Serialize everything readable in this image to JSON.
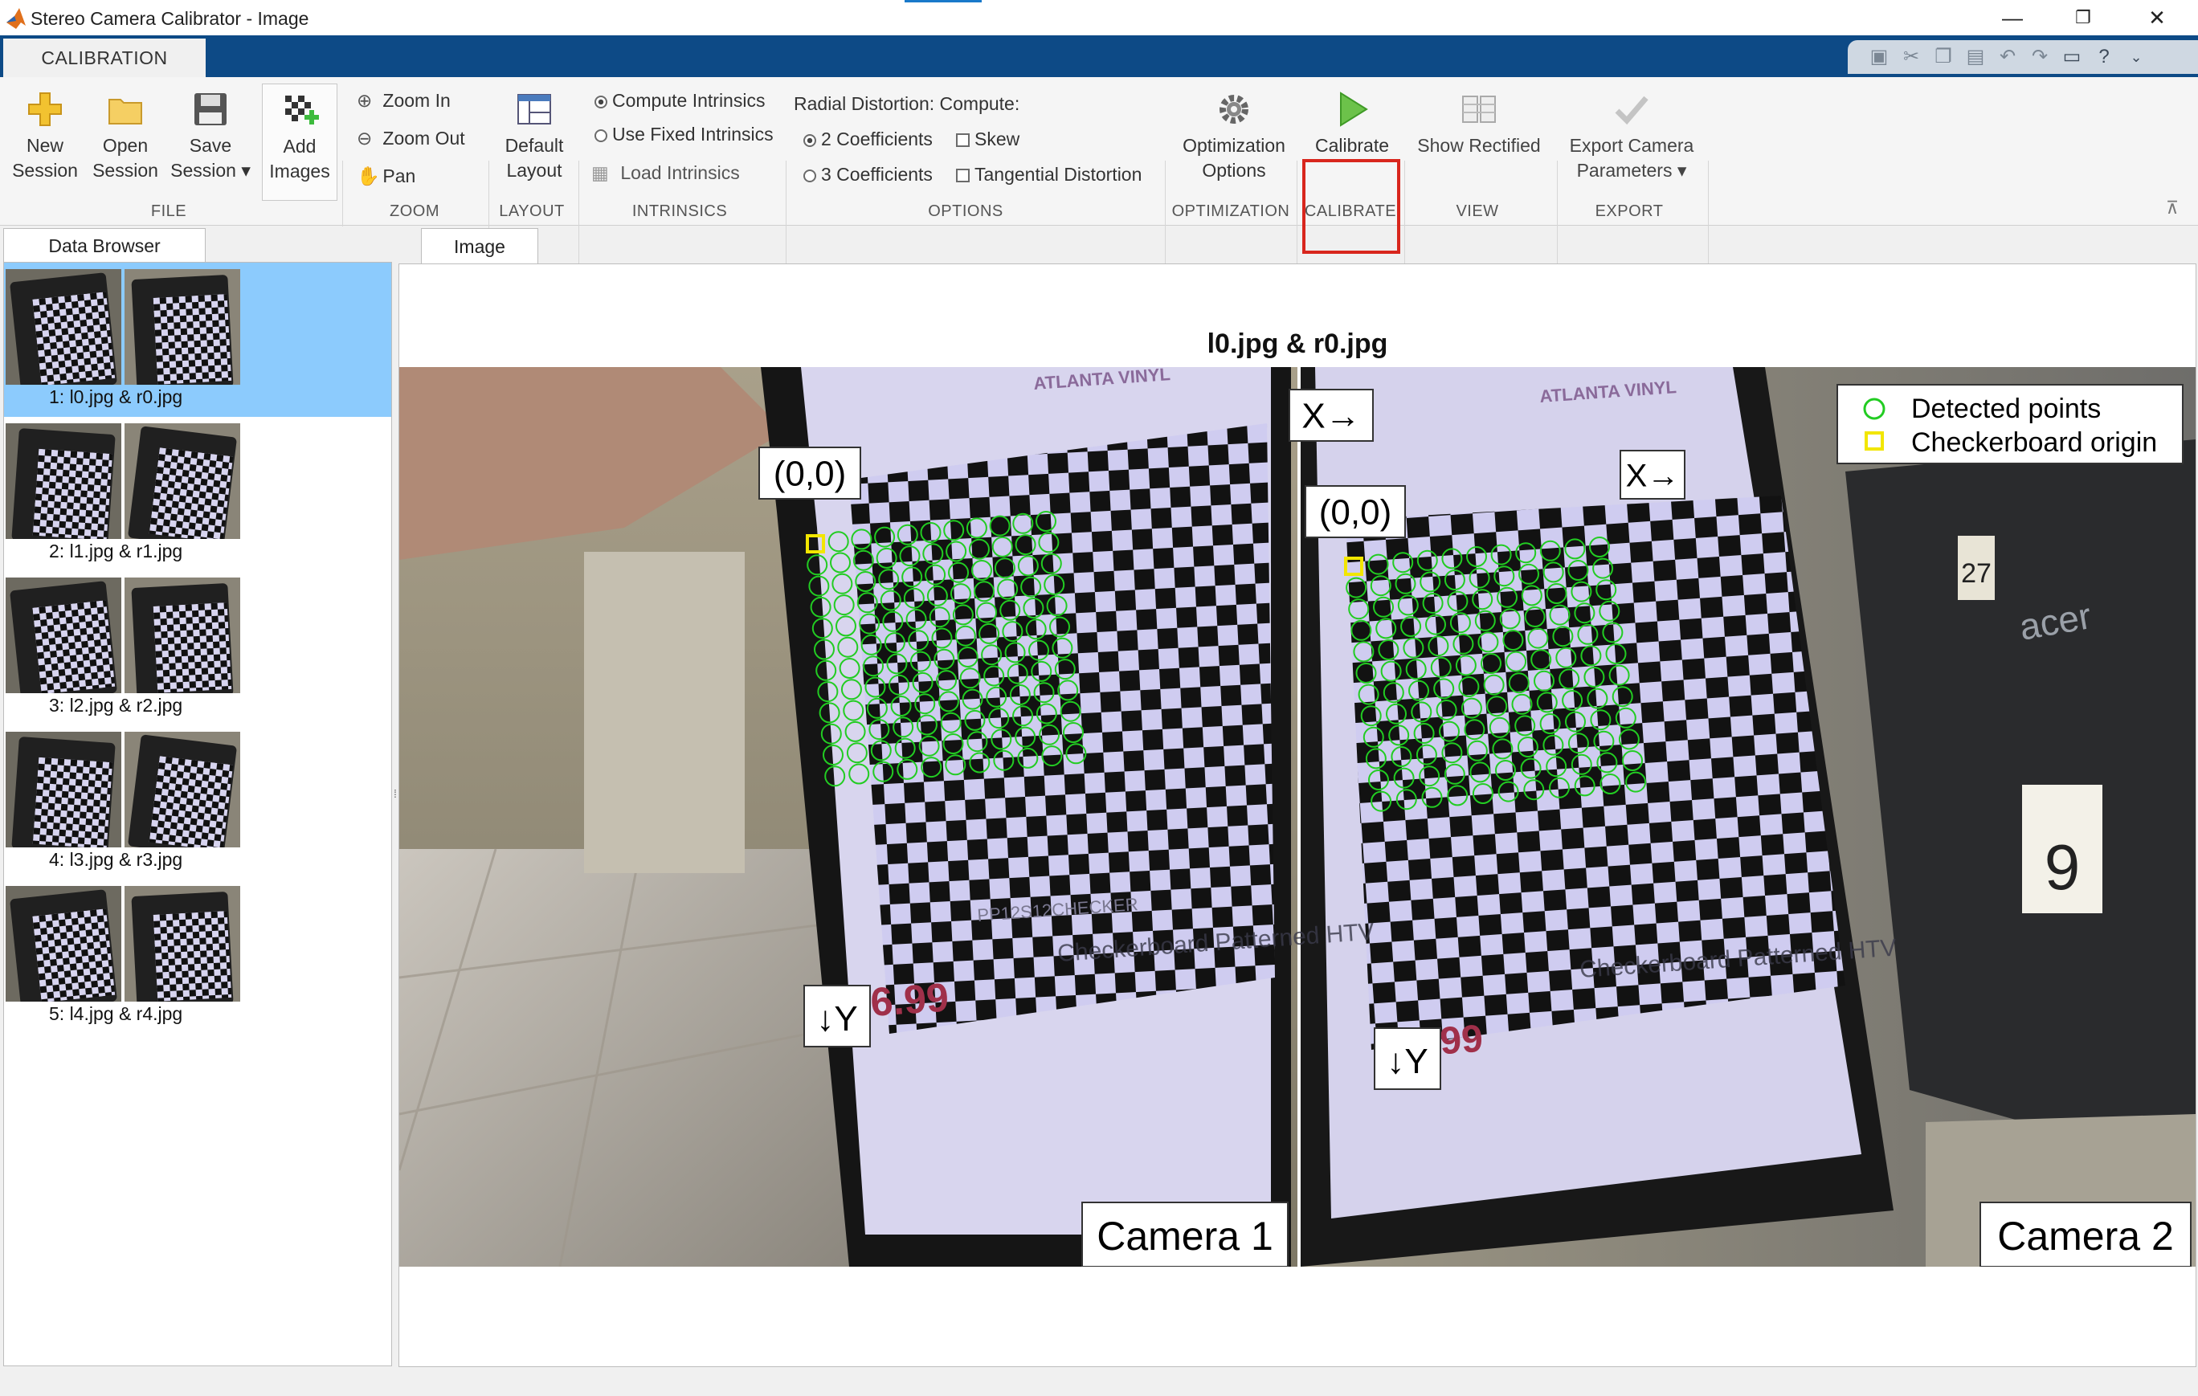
{
  "window": {
    "title": "Stereo Camera Calibrator - Image",
    "minimize": "—",
    "restore": "❐",
    "close": "✕"
  },
  "tabs": {
    "calibration": "CALIBRATION"
  },
  "ribbon": {
    "file": {
      "group_label": "FILE",
      "new_session": [
        "New",
        "Session"
      ],
      "open_session": [
        "Open",
        "Session"
      ],
      "save_session": [
        "Save",
        "Session ▾"
      ],
      "add_images": [
        "Add",
        "Images"
      ]
    },
    "zoom": {
      "group_label": "ZOOM",
      "zoom_in": "Zoom In",
      "zoom_out": "Zoom Out",
      "pan": "Pan"
    },
    "layout": {
      "group_label": "LAYOUT",
      "default_layout": [
        "Default",
        "Layout"
      ]
    },
    "intrinsics": {
      "group_label": "INTRINSICS",
      "compute": "Compute Intrinsics",
      "use_fixed": "Use Fixed Intrinsics",
      "load": "Load Intrinsics",
      "selected": "compute"
    },
    "options": {
      "group_label": "OPTIONS",
      "radial_label": "Radial Distortion: Compute:",
      "coef2": "2 Coefficients",
      "coef3": "3 Coefficients",
      "skew": "Skew",
      "tangential": "Tangential Distortion",
      "selected_coefficients": 2,
      "skew_checked": false,
      "tangential_checked": false
    },
    "optimization": {
      "group_label": "OPTIMIZATION",
      "options": [
        "Optimization",
        "Options"
      ]
    },
    "calibrate": {
      "group_label": "CALIBRATE",
      "label": "Calibrate",
      "highlight_color": "#d8261d"
    },
    "view": {
      "group_label": "VIEW",
      "show_rectified": "Show Rectified"
    },
    "export": {
      "group_label": "EXPORT",
      "export_params": [
        "Export Camera",
        "Parameters ▾"
      ]
    }
  },
  "data_browser": {
    "tab_label": "Data Browser",
    "selected_index": 0,
    "pairs": [
      {
        "label": "1: l0.jpg & r0.jpg"
      },
      {
        "label": "2: l1.jpg & r1.jpg"
      },
      {
        "label": "3: l2.jpg & r2.jpg"
      },
      {
        "label": "4: l3.jpg & r3.jpg"
      },
      {
        "label": "5: l4.jpg & r4.jpg"
      }
    ]
  },
  "image_panel": {
    "tab_label": "Image",
    "figure_title": "l0.jpg & r0.jpg",
    "left": {
      "camera_label": "Camera 1",
      "origin_label": "(0,0)",
      "x_axis_label": "X→",
      "y_axis_label": "↓Y",
      "product_text": "Checkerboard Patterned HTV",
      "price": "$6.99",
      "code_text": "PP12S12CHECKER",
      "brand_text": "ATLANTA VINYL"
    },
    "right": {
      "camera_label": "Camera 2",
      "origin_label": "(0,0)",
      "x_axis_label": "X→",
      "y_axis_label": "↓Y",
      "product_text": "Checkerboard Patterned HTV",
      "price": "$6.99",
      "brand_text": "ATLANTA VINYL",
      "monitor_brand": "acer",
      "sign_9": "9",
      "sign_27": "27"
    },
    "legend": {
      "detected": "Detected points",
      "origin": "Checkerboard origin",
      "detected_color": "#22cc22",
      "origin_color": "#f2e600"
    },
    "grid": {
      "rows": 12,
      "cols": 11
    }
  }
}
